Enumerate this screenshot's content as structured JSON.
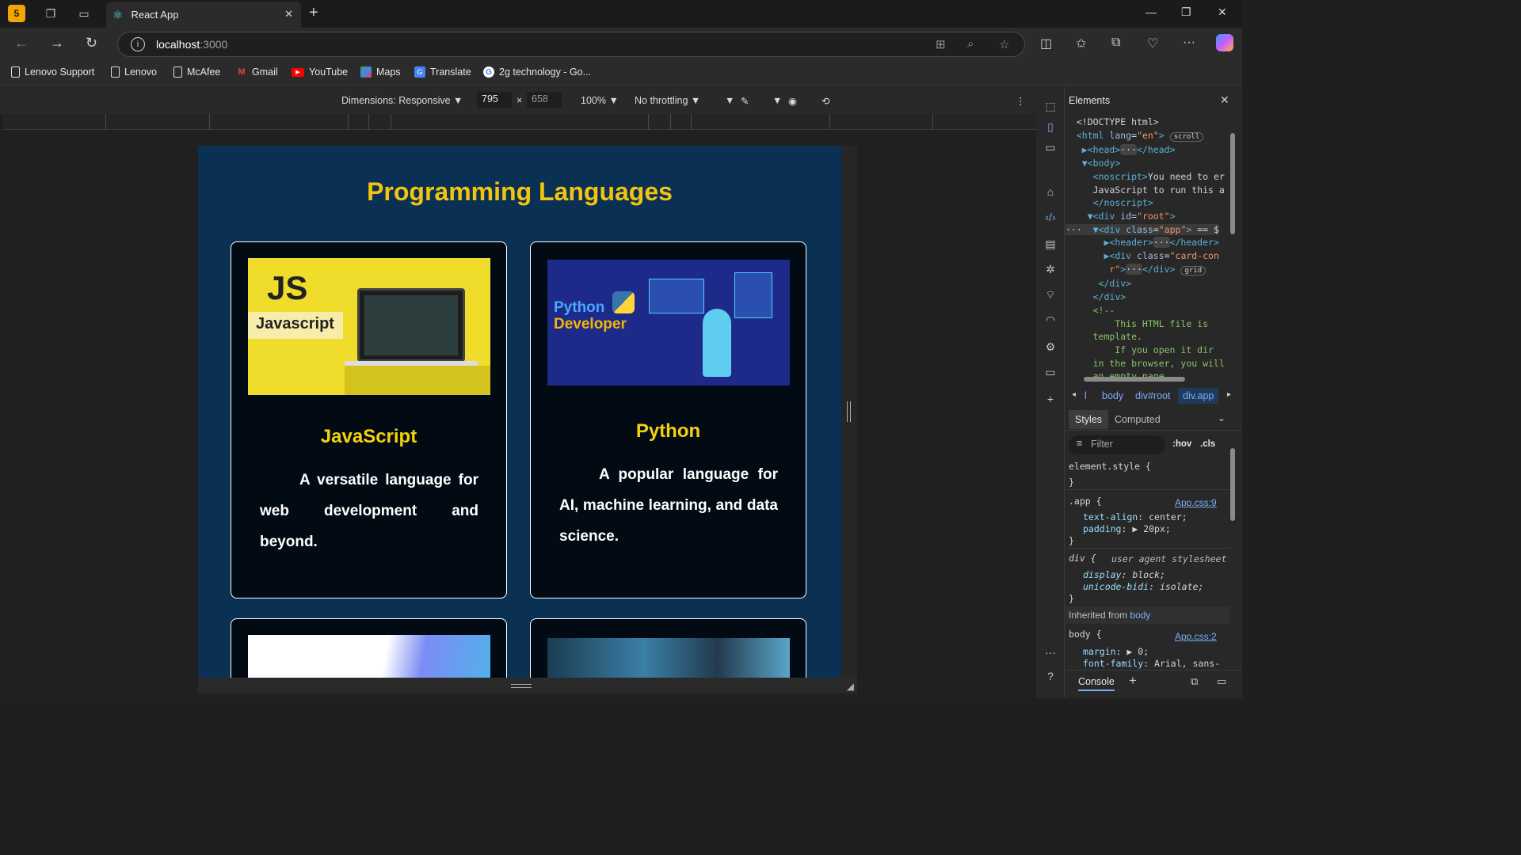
{
  "browser": {
    "tab_title": "React App",
    "url_host": "localhost",
    "url_port": ":3000",
    "bookmarks": [
      {
        "label": "Lenovo Support",
        "icon": "page-icon"
      },
      {
        "label": "Lenovo",
        "icon": "page-icon"
      },
      {
        "label": "McAfee",
        "icon": "page-icon"
      },
      {
        "label": "Gmail",
        "icon": "gmail-icon"
      },
      {
        "label": "YouTube",
        "icon": "youtube-icon"
      },
      {
        "label": "Maps",
        "icon": "maps-icon"
      },
      {
        "label": "Translate",
        "icon": "translate-icon"
      },
      {
        "label": "2g technology - Go...",
        "icon": "google-icon"
      }
    ]
  },
  "device_toolbar": {
    "dimensions_label": "Dimensions: Responsive",
    "width": "795",
    "height": "658",
    "times": "×",
    "zoom": "100%",
    "throttling": "No throttling"
  },
  "page": {
    "heading": "Programming Languages",
    "cards": [
      {
        "title": "JavaScript",
        "description": "A versatile language for web development and beyond.",
        "img_big": "JS",
        "img_sub": "Javascript"
      },
      {
        "title": "Python",
        "description": "A popular language for AI, machine learning, and data science.",
        "img_line1": "Python",
        "img_line2": "Developer"
      }
    ]
  },
  "devtools": {
    "panel_title": "Elements",
    "breadcrumbs": [
      "l",
      "body",
      "div#root",
      "div.app"
    ],
    "style_tabs": [
      "Styles",
      "Computed"
    ],
    "filter_placeholder": "Filter",
    "hov": ":hov",
    "cls": ".cls",
    "rules": {
      "element_style": "element.style {",
      "app_selector": ".app {",
      "app_source": "App.css:9",
      "app_prop1": "text-align",
      "app_val1": "center;",
      "app_prop2": "padding",
      "app_val2": "▶ 20px;",
      "div_selector": "div {",
      "div_source": "user agent stylesheet",
      "div_prop1": "display",
      "div_val1": "block;",
      "div_prop2": "unicode-bidi",
      "div_val2": "isolate;",
      "inherited_label": "Inherited from",
      "inherited_from": "body",
      "body_selector": "body {",
      "body_source": "App.css:2",
      "body_prop1": "margin",
      "body_val1": "▶ 0;",
      "body_prop2": "font-family",
      "body_val2": "Arial, sans-"
    },
    "console_label": "Console"
  }
}
